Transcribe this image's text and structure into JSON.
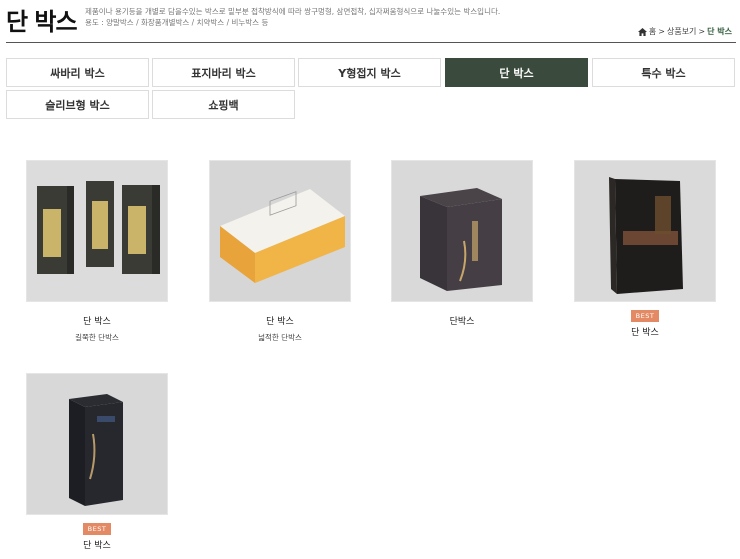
{
  "header": {
    "title": "단 박스",
    "description_line1": "제품이나 용기등을 개별로 담을수있는 박스로 밑부분 접착방식에 따라 쌍구멍형, 삼면접착, 십자쩌움형식으로 나눌수있는 박스입니다.",
    "description_line2": "용도 : 양말박스 / 화장품개별박스 / 치약박스 / 비누박스 등",
    "breadcrumb": {
      "home_icon": "home-icon",
      "home": "홈",
      "sep": ">",
      "level1": "상품보기",
      "current": "단 박스"
    }
  },
  "categories": [
    {
      "label": "싸바리 박스",
      "active": false
    },
    {
      "label": "표지바리 박스",
      "active": false
    },
    {
      "label": "Y형접지 박스",
      "active": false
    },
    {
      "label": "단 박스",
      "active": true
    },
    {
      "label": "특수 박스",
      "active": false
    },
    {
      "label": "슬리브형 박스",
      "active": false
    },
    {
      "label": "쇼핑백",
      "active": false
    }
  ],
  "products": [
    {
      "name": "단 박스",
      "subtitle": "길쭉한 단박스",
      "badge": ""
    },
    {
      "name": "단 박스",
      "subtitle": "넓적한 단박스",
      "badge": ""
    },
    {
      "name": "단박스",
      "subtitle": "",
      "badge": ""
    },
    {
      "name": "단 박스",
      "subtitle": "",
      "badge": "BEST"
    },
    {
      "name": "단 박스",
      "subtitle": "",
      "badge": "BEST"
    }
  ],
  "colors": {
    "accent_green": "#3a4a3c",
    "badge_orange": "#e38a64"
  }
}
